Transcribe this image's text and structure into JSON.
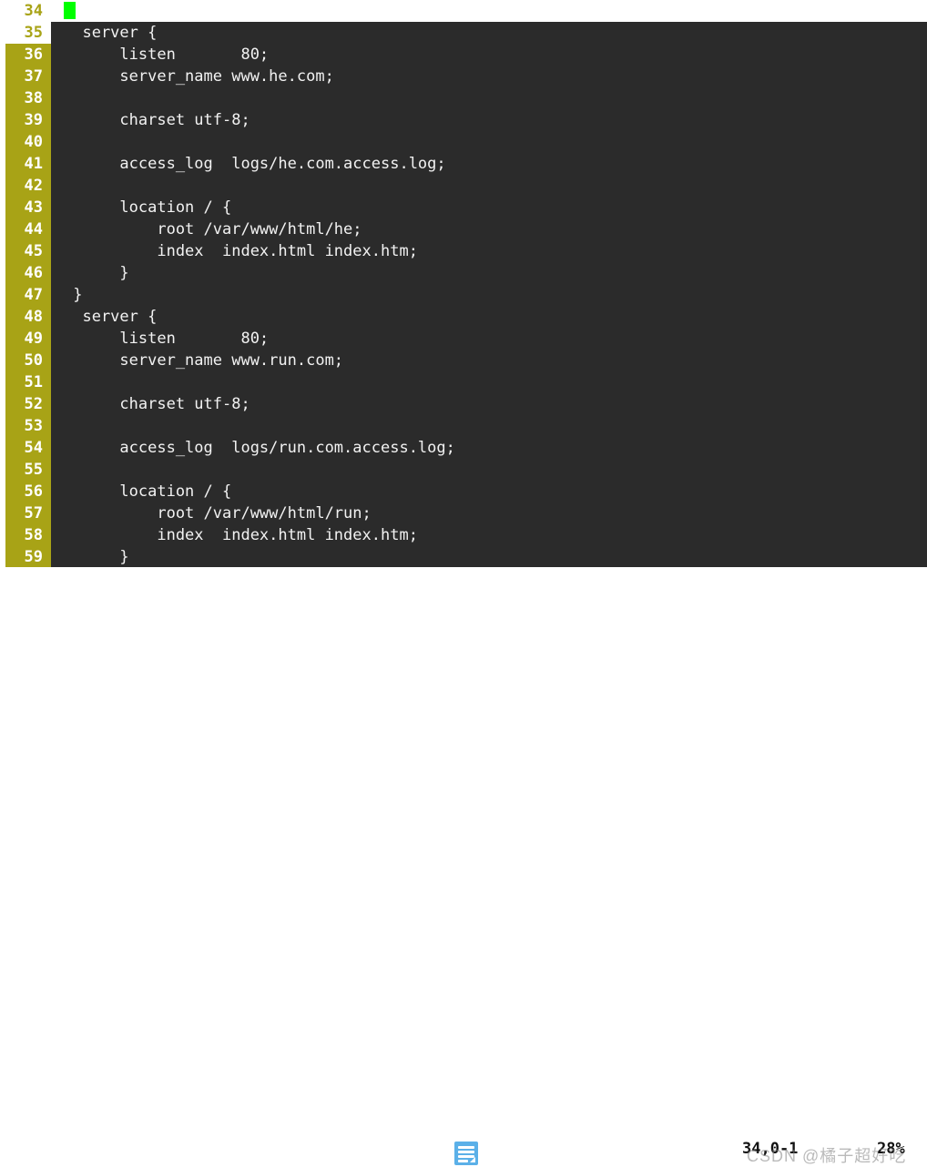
{
  "app": {
    "kind": "terminal-text-editor",
    "colors": {
      "code_background": "#2b2b2b",
      "code_foreground": "#f2f2f2",
      "gutter_background": "#a8a316",
      "gutter_foreground": "#ffffff",
      "gutter_head_background": "#ffffff",
      "gutter_head_foreground": "#a8a316",
      "cursor": "#00ff00",
      "statusbar_background": "#ffffff",
      "ime_icon": "#5bb0e8"
    }
  },
  "editor": {
    "lines": [
      {
        "number": "34",
        "text": "",
        "gutter_style": "white",
        "blank_row": true,
        "cursor": true
      },
      {
        "number": "35",
        "text": "  server {",
        "gutter_style": "white",
        "blank_row": false,
        "cursor": false
      },
      {
        "number": "36",
        "text": "      listen       80;",
        "gutter_style": "olive",
        "blank_row": false,
        "cursor": false
      },
      {
        "number": "37",
        "text": "      server_name www.he.com;",
        "gutter_style": "olive",
        "blank_row": false,
        "cursor": false
      },
      {
        "number": "38",
        "text": "",
        "gutter_style": "olive",
        "blank_row": false,
        "cursor": false
      },
      {
        "number": "39",
        "text": "      charset utf-8;",
        "gutter_style": "olive",
        "blank_row": false,
        "cursor": false
      },
      {
        "number": "40",
        "text": "",
        "gutter_style": "olive",
        "blank_row": false,
        "cursor": false
      },
      {
        "number": "41",
        "text": "      access_log  logs/he.com.access.log;",
        "gutter_style": "olive",
        "blank_row": false,
        "cursor": false
      },
      {
        "number": "42",
        "text": "",
        "gutter_style": "olive",
        "blank_row": false,
        "cursor": false
      },
      {
        "number": "43",
        "text": "      location / {",
        "gutter_style": "olive",
        "blank_row": false,
        "cursor": false
      },
      {
        "number": "44",
        "text": "          root /var/www/html/he;",
        "gutter_style": "olive",
        "blank_row": false,
        "cursor": false
      },
      {
        "number": "45",
        "text": "          index  index.html index.htm;",
        "gutter_style": "olive",
        "blank_row": false,
        "cursor": false
      },
      {
        "number": "46",
        "text": "      }",
        "gutter_style": "olive",
        "blank_row": false,
        "cursor": false
      },
      {
        "number": "47",
        "text": " }",
        "gutter_style": "olive",
        "blank_row": false,
        "cursor": false
      },
      {
        "number": "48",
        "text": "  server {",
        "gutter_style": "olive",
        "blank_row": false,
        "cursor": false
      },
      {
        "number": "49",
        "text": "      listen       80;",
        "gutter_style": "olive",
        "blank_row": false,
        "cursor": false
      },
      {
        "number": "50",
        "text": "      server_name www.run.com;",
        "gutter_style": "olive",
        "blank_row": false,
        "cursor": false
      },
      {
        "number": "51",
        "text": "",
        "gutter_style": "olive",
        "blank_row": false,
        "cursor": false
      },
      {
        "number": "52",
        "text": "      charset utf-8;",
        "gutter_style": "olive",
        "blank_row": false,
        "cursor": false
      },
      {
        "number": "53",
        "text": "",
        "gutter_style": "olive",
        "blank_row": false,
        "cursor": false
      },
      {
        "number": "54",
        "text": "      access_log  logs/run.com.access.log;",
        "gutter_style": "olive",
        "blank_row": false,
        "cursor": false
      },
      {
        "number": "55",
        "text": "",
        "gutter_style": "olive",
        "blank_row": false,
        "cursor": false
      },
      {
        "number": "56",
        "text": "      location / {",
        "gutter_style": "olive",
        "blank_row": false,
        "cursor": false
      },
      {
        "number": "57",
        "text": "          root /var/www/html/run;",
        "gutter_style": "olive",
        "blank_row": false,
        "cursor": false
      },
      {
        "number": "58",
        "text": "          index  index.html index.htm;",
        "gutter_style": "olive",
        "blank_row": false,
        "cursor": false
      },
      {
        "number": "59",
        "text": "      }",
        "gutter_style": "olive",
        "blank_row": false,
        "cursor": false
      }
    ]
  },
  "statusbar": {
    "ime_icon_name": "input-method-document-icon",
    "ruler": "34,0-1",
    "percent": "28%"
  },
  "watermark": {
    "text": "CSDN @橘子超好吃"
  }
}
